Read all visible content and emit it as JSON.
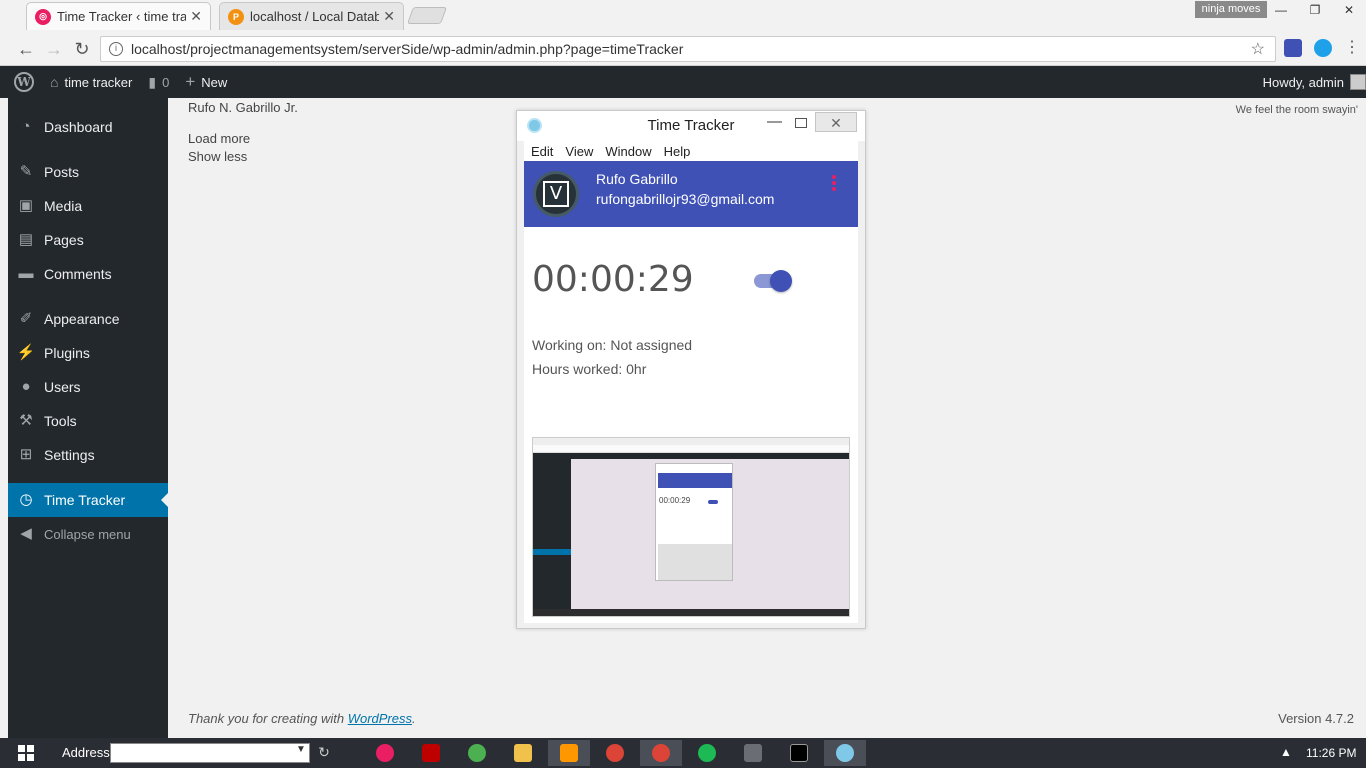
{
  "browser": {
    "tabs": [
      {
        "title": "Time Tracker ‹ time track",
        "active": true,
        "favicon_color": "#e91e63"
      },
      {
        "title": "localhost / Local Databas",
        "active": false,
        "favicon_color": "#f29111"
      }
    ],
    "profile_name": "ninja moves",
    "url": "localhost/projectmanagementsystem/serverSide/wp-admin/admin.php?page=timeTracker"
  },
  "adminbar": {
    "site_name": "time tracker",
    "comments_count": "0",
    "new_label": "New",
    "howdy": "Howdy, admin"
  },
  "sidebar": {
    "items": [
      {
        "label": "Dashboard",
        "icon": "dashboard-icon"
      },
      {
        "label": "Posts",
        "icon": "pin-icon"
      },
      {
        "label": "Media",
        "icon": "media-icon"
      },
      {
        "label": "Pages",
        "icon": "pages-icon"
      },
      {
        "label": "Comments",
        "icon": "comments-icon"
      },
      {
        "label": "Appearance",
        "icon": "brush-icon"
      },
      {
        "label": "Plugins",
        "icon": "plug-icon"
      },
      {
        "label": "Users",
        "icon": "users-icon"
      },
      {
        "label": "Tools",
        "icon": "wrench-icon"
      },
      {
        "label": "Settings",
        "icon": "settings-icon"
      },
      {
        "label": "Time Tracker",
        "icon": "clock-icon",
        "current": true
      },
      {
        "label": "Collapse menu",
        "icon": "collapse-icon"
      }
    ]
  },
  "content": {
    "author": "Rufo N. Gabrillo Jr.",
    "load_more": "Load more",
    "show_less": "Show less",
    "lyric": "We feel the room swayin'",
    "footer_prefix": "Thank you for creating with ",
    "footer_link": "WordPress",
    "footer_suffix": ".",
    "version": "Version 4.7.2"
  },
  "tracker": {
    "title": "Time Tracker",
    "menu": [
      "Edit",
      "View",
      "Window",
      "Help"
    ],
    "user_name": "Rufo Gabrillo",
    "user_email": "rufongabrillojr93@gmail.com",
    "timer": "00:00:29",
    "tracking_on": true,
    "working_on": "Working on: Not assigned",
    "hours_worked": "Hours worked: 0hr",
    "accent_color": "#3f51b5"
  },
  "taskbar": {
    "address_label": "Address",
    "clock": "11:26 PM"
  }
}
